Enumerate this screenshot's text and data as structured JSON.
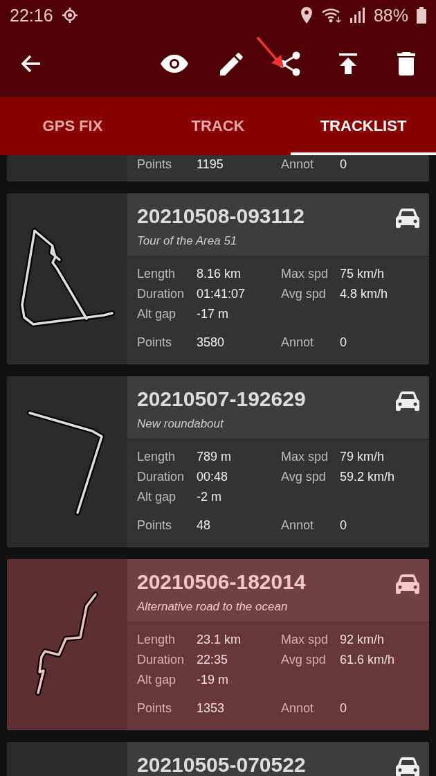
{
  "status_bar": {
    "time": "22:16",
    "battery": "88%"
  },
  "tabs": [
    {
      "label": "GPS FIX",
      "selected": false
    },
    {
      "label": "TRACK",
      "selected": false
    },
    {
      "label": "TRACKLIST",
      "selected": true
    }
  ],
  "tracks": [
    {
      "selected": false,
      "counts": [
        {
          "label": "Points",
          "value": "1195"
        },
        {
          "label": "Annot",
          "value": "0"
        }
      ]
    },
    {
      "title": "20210508-093112",
      "subtitle": "Tour of the Area 51",
      "selected": false,
      "details": [
        {
          "label": "Length",
          "value": "8.16 km"
        },
        {
          "label": "Max spd",
          "value": "75 km/h"
        },
        {
          "label": "Duration",
          "value": "01:41:07"
        },
        {
          "label": "Avg spd",
          "value": "4.8 km/h"
        },
        {
          "label": "Alt gap",
          "value": "-17 m"
        }
      ],
      "counts": [
        {
          "label": "Points",
          "value": "3580"
        },
        {
          "label": "Annot",
          "value": "0"
        }
      ]
    },
    {
      "title": "20210507-192629",
      "subtitle": "New roundabout",
      "selected": false,
      "details": [
        {
          "label": "Length",
          "value": "789 m"
        },
        {
          "label": "Max spd",
          "value": "79 km/h"
        },
        {
          "label": "Duration",
          "value": "00:48"
        },
        {
          "label": "Avg spd",
          "value": "59.2 km/h"
        },
        {
          "label": "Alt gap",
          "value": "-2 m"
        }
      ],
      "counts": [
        {
          "label": "Points",
          "value": "48"
        },
        {
          "label": "Annot",
          "value": "0"
        }
      ]
    },
    {
      "title": "20210506-182014",
      "subtitle": "Alternative road to the ocean",
      "selected": true,
      "details": [
        {
          "label": "Length",
          "value": "23.1 km"
        },
        {
          "label": "Max spd",
          "value": "92 km/h"
        },
        {
          "label": "Duration",
          "value": "22:35"
        },
        {
          "label": "Avg spd",
          "value": "61.6 km/h"
        },
        {
          "label": "Alt gap",
          "value": "-19 m"
        }
      ],
      "counts": [
        {
          "label": "Points",
          "value": "1353"
        },
        {
          "label": "Annot",
          "value": "0"
        }
      ]
    },
    {
      "title": "20210505-070522",
      "selected": false
    }
  ]
}
